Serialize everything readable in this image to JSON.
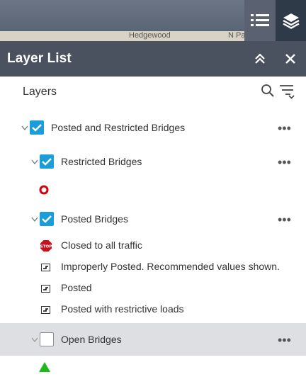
{
  "map": {
    "street_labels": [
      "Hedgewood",
      "N Pamona Rd"
    ]
  },
  "header": {
    "title": "Layer List",
    "collapse_glyph": "≫",
    "close_glyph": "×",
    "background_color": "#4a5260"
  },
  "toolbar": {
    "layers_label": "Layers"
  },
  "layers": [
    {
      "label": "Posted and Restricted Bridges",
      "checked": true
    },
    {
      "label": "Restricted Bridges",
      "checked": true
    },
    {
      "label": "Posted Bridges",
      "checked": true
    },
    {
      "label": "Open Bridges",
      "checked": false
    }
  ],
  "legend": {
    "posted": [
      {
        "label": "Closed to all traffic",
        "symbol": "stop-sign-icon"
      },
      {
        "label": "Improperly Posted. Recommended values shown.",
        "symbol": "load-sign-icon"
      },
      {
        "label": "Posted",
        "symbol": "load-sign-icon"
      },
      {
        "label": "Posted with restrictive loads",
        "symbol": "load-sign-icon"
      }
    ],
    "restricted_symbol": "red-ring-icon",
    "open_symbol": "green-triangle-icon"
  },
  "more_glyph": "•••",
  "colors": {
    "checkbox": "#1a9dd9",
    "highlight_row": "#dedfe2",
    "restricted_ring": "#d9000d",
    "open_triangle": "#1fb81f"
  }
}
